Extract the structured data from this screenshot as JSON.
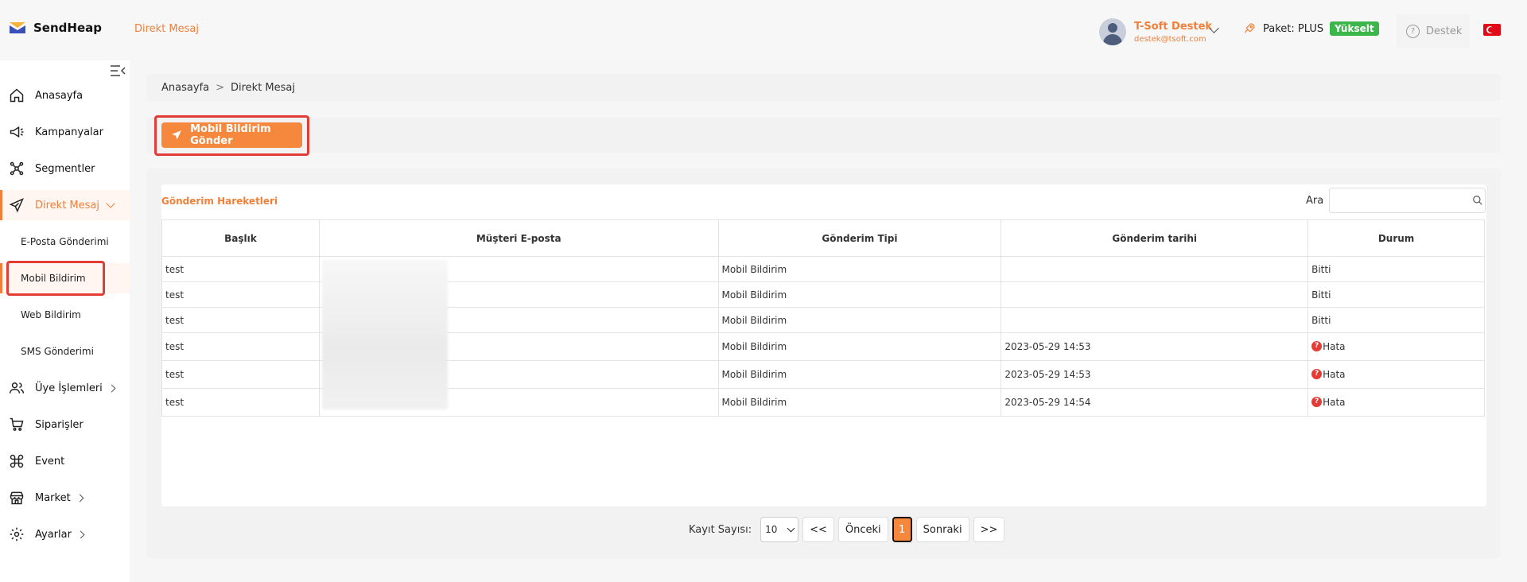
{
  "brand": {
    "name": "SendHeap"
  },
  "header": {
    "title": "Direkt Mesaj",
    "user_name": "T-Soft Destek",
    "user_email": "destek@tsoft.com",
    "package_label": "Paket: PLUS",
    "upgrade_label": "Yükselt",
    "support_label": "Destek"
  },
  "sidebar": {
    "items": [
      {
        "label": "Anasayfa",
        "icon": "home-icon"
      },
      {
        "label": "Kampanyalar",
        "icon": "megaphone-icon"
      },
      {
        "label": "Segmentler",
        "icon": "network-icon"
      },
      {
        "label": "Direkt Mesaj",
        "icon": "send-icon"
      },
      {
        "label": "Üye İşlemleri",
        "icon": "users-icon"
      },
      {
        "label": "Siparişler",
        "icon": "cart-icon"
      },
      {
        "label": "Event",
        "icon": "command-icon"
      },
      {
        "label": "Market",
        "icon": "store-icon"
      },
      {
        "label": "Ayarlar",
        "icon": "gear-icon"
      }
    ],
    "subitems": [
      {
        "label": "E-Posta Gönderimi"
      },
      {
        "label": "Mobil Bildirim"
      },
      {
        "label": "Web Bildirim"
      },
      {
        "label": "SMS Gönderimi"
      }
    ]
  },
  "breadcrumb": {
    "home": "Anasayfa",
    "sep": ">",
    "current": "Direkt Mesaj"
  },
  "actions": {
    "send_label": "Mobil Bildirim Gönder"
  },
  "table": {
    "title": "Gönderim Hareketleri",
    "search_label": "Ara",
    "search_value": "",
    "columns": [
      "Başlık",
      "Müşteri E-posta",
      "Gönderim Tipi",
      "Gönderim tarihi",
      "Durum"
    ],
    "rows": [
      {
        "title": "test",
        "email": "",
        "type": "Mobil Bildirim",
        "date": "",
        "status": "Bitti",
        "error": false
      },
      {
        "title": "test",
        "email": "",
        "type": "Mobil Bildirim",
        "date": "",
        "status": "Bitti",
        "error": false
      },
      {
        "title": "test",
        "email": "",
        "type": "Mobil Bildirim",
        "date": "",
        "status": "Bitti",
        "error": false
      },
      {
        "title": "test",
        "email": "",
        "type": "Mobil Bildirim",
        "date": "2023-05-29 14:53",
        "status": "Hata",
        "error": true
      },
      {
        "title": "test",
        "email": "",
        "type": "Mobil Bildirim",
        "date": "2023-05-29 14:53",
        "status": "Hata",
        "error": true
      },
      {
        "title": "test",
        "email": "",
        "type": "Mobil Bildirim",
        "date": "2023-05-29 14:54",
        "status": "Hata",
        "error": true
      }
    ]
  },
  "pagination": {
    "count_label": "Kayıt Sayısı:",
    "page_size": "10",
    "first_label": "<<",
    "prev_label": "Önceki",
    "current_page": "1",
    "next_label": "Sonraki",
    "last_label": ">>"
  },
  "colors": {
    "accent": "#f07f3a",
    "button": "#f5883d",
    "success": "#3cb54a",
    "highlight": "#e53b37"
  }
}
